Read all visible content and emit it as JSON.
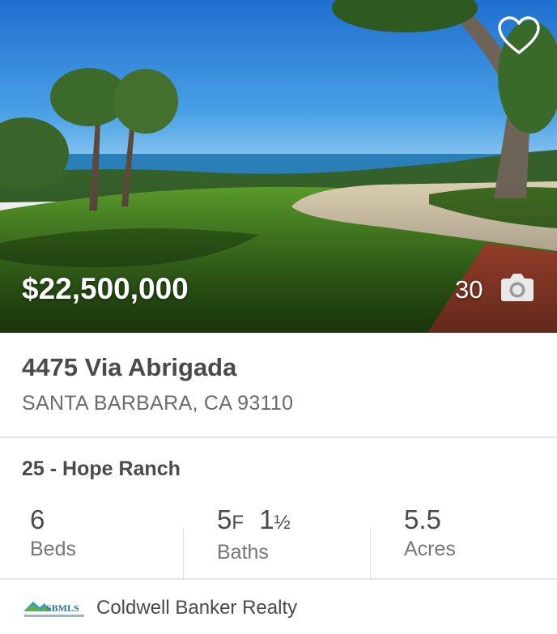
{
  "listing": {
    "price": "$22,500,000",
    "photo_count": "30",
    "street": "4475 Via Abrigada",
    "city_state_zip": "SANTA BARBARA, CA 93110",
    "area": "25 - Hope Ranch",
    "beds": {
      "value": "6",
      "label": "Beds"
    },
    "baths": {
      "full": "5",
      "full_suffix": "F",
      "half": "1",
      "half_suffix": "½",
      "label": "Baths"
    },
    "acres": {
      "value": "5.5",
      "label": "Acres"
    },
    "mls_logo_text": "SBMLS",
    "broker": "Coldwell Banker Realty"
  },
  "icons": {
    "favorite": "heart-outline-icon",
    "photos": "camera-icon"
  },
  "colors": {
    "sky": "#2a86d6",
    "ocean": "#2b7fb8",
    "lawn": "#3f7d1f",
    "driveway": "#d9cdb0",
    "brick": "#b24a32",
    "text_primary": "#4a4a4a",
    "text_secondary": "#777777",
    "divider": "#e6e6e6"
  }
}
